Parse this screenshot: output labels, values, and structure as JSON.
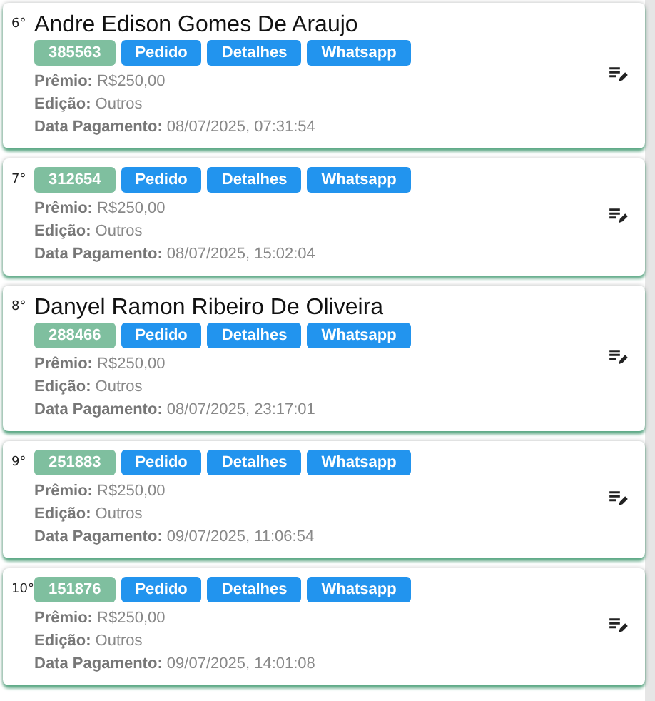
{
  "entries": [
    {
      "rank": "6°",
      "name": "Andre Edison Gomes De Araujo",
      "code": "385563",
      "buttons": [
        "Pedido",
        "Detalhes",
        "Whatsapp"
      ],
      "fields": [
        {
          "label": "Prêmio:",
          "value": "R$250,00"
        },
        {
          "label": "Edição:",
          "value": "Outros"
        },
        {
          "label": "Data Pagamento:",
          "value": "08/07/2025, 07:31:54"
        }
      ]
    },
    {
      "rank": "7°",
      "code": "312654",
      "buttons": [
        "Pedido",
        "Detalhes",
        "Whatsapp"
      ],
      "fields": [
        {
          "label": "Prêmio:",
          "value": "R$250,00"
        },
        {
          "label": "Edição:",
          "value": "Outros"
        },
        {
          "label": "Data Pagamento:",
          "value": "08/07/2025, 15:02:04"
        }
      ]
    },
    {
      "rank": "8°",
      "name": "Danyel Ramon Ribeiro De Oliveira",
      "code": "288466",
      "buttons": [
        "Pedido",
        "Detalhes",
        "Whatsapp"
      ],
      "fields": [
        {
          "label": "Prêmio:",
          "value": "R$250,00"
        },
        {
          "label": "Edição:",
          "value": "Outros"
        },
        {
          "label": "Data Pagamento:",
          "value": "08/07/2025, 23:17:01"
        }
      ]
    },
    {
      "rank": "9°",
      "code": "251883",
      "buttons": [
        "Pedido",
        "Detalhes",
        "Whatsapp"
      ],
      "fields": [
        {
          "label": "Prêmio:",
          "value": "R$250,00"
        },
        {
          "label": "Edição:",
          "value": "Outros"
        },
        {
          "label": "Data Pagamento:",
          "value": "09/07/2025, 11:06:54"
        }
      ]
    },
    {
      "rank": "10°",
      "code": "151876",
      "buttons": [
        "Pedido",
        "Detalhes",
        "Whatsapp"
      ],
      "fields": [
        {
          "label": "Prêmio:",
          "value": "R$250,00"
        },
        {
          "label": "Edição:",
          "value": "Outros"
        },
        {
          "label": "Data Pagamento:",
          "value": "09/07/2025, 14:01:08"
        }
      ]
    }
  ]
}
